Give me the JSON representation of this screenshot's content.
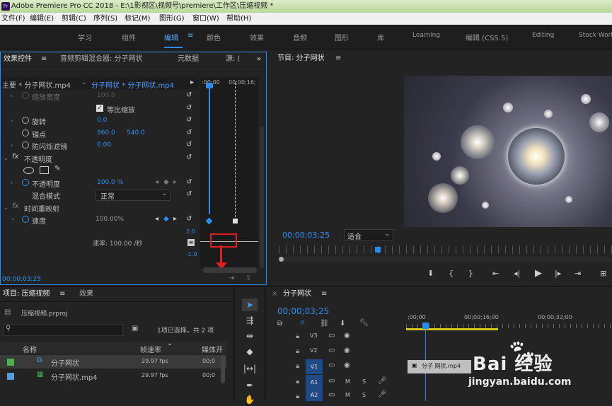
{
  "title_bar": {
    "app_icon": "Pr",
    "text": "Adobe Premiere Pro CC 2018 - E:\\1影视区\\视频号\\premiere\\工作区\\压缩视频 *"
  },
  "menu": [
    "文件(F)",
    "编辑(E)",
    "剪辑(C)",
    "序列(S)",
    "标记(M)",
    "图形(G)",
    "窗口(W)",
    "帮助(H)"
  ],
  "workspaces": [
    "学习",
    "组件",
    "编辑",
    "颜色",
    "效果",
    "音频",
    "图形",
    "库",
    "Learning",
    "编辑 (CS5.5)",
    "Editing",
    "Stock Work"
  ],
  "workspace_active": "编辑",
  "effect_controls": {
    "tabs": [
      "效果控件",
      "音频剪辑混合器: 分子网状",
      "元数据",
      "源: ("
    ],
    "master": "主要 * 分子网状.mp4",
    "clip": "分子网状 * 分子网状.mp4",
    "ruler_start": ":00;00",
    "ruler_end": "00;00;16;",
    "rows": {
      "scale_width": {
        "label": "缩放宽度",
        "value": "100.0"
      },
      "uniform_scale": {
        "label": "等比缩放",
        "checked": true
      },
      "rotation": {
        "label": "旋转",
        "value": "0.0"
      },
      "anchor": {
        "label": "锚点",
        "x": "960.0",
        "y": "540.0"
      },
      "flicker": {
        "label": "防闪烁滤镜",
        "value": "0.00"
      },
      "opacity_group": {
        "label": "不透明度"
      },
      "opacity": {
        "label": "不透明度",
        "value": "100.0 %"
      },
      "blend": {
        "label": "混合模式",
        "value": "正常"
      },
      "time_remap": {
        "label": "时间重映射"
      },
      "speed": {
        "label": "速度",
        "value": "100.00%"
      },
      "rate_label": "速率: 100.00 /秒",
      "graph_top": "2.0",
      "graph_bottom": "-1.0"
    },
    "timecode": "00;00;03;25"
  },
  "program": {
    "title": "节目: 分子网状",
    "timecode": "00;00;03;25",
    "fit": "适合"
  },
  "project": {
    "tabs": [
      "项目: 压缩视频",
      "效果"
    ],
    "file": "压缩视频.prproj",
    "selection": "1项已选择，共 2 项",
    "columns": [
      "名称",
      "帧速率",
      "媒体开"
    ],
    "items": [
      {
        "name": "分子网状",
        "fps": "29.97 fps",
        "media": "00;0",
        "color": "#4caf50",
        "selected": true
      },
      {
        "name": "分子网状.mp4",
        "fps": "29.97 fps",
        "media": "00;0",
        "color": "#5b9bd5",
        "selected": false
      }
    ]
  },
  "timeline": {
    "title": "分子网状",
    "timecode": "00;00;03;25",
    "ruler": [
      ";00;00",
      "00;00;16;00",
      "00;00;32;00"
    ],
    "tracks": [
      "V3",
      "V2",
      "V1",
      "A1",
      "A2"
    ],
    "clip": "分子 网状.mp4",
    "track_mute": "M",
    "track_solo": "S"
  },
  "watermark": {
    "brand": "Bai 经验",
    "url": "jingyan.baidu.com"
  },
  "colors": {
    "accent": "#2d8ceb",
    "value_blue": "#2f8ff0",
    "highlight_red": "#e02020",
    "active_tab": "#5aa8ff"
  }
}
